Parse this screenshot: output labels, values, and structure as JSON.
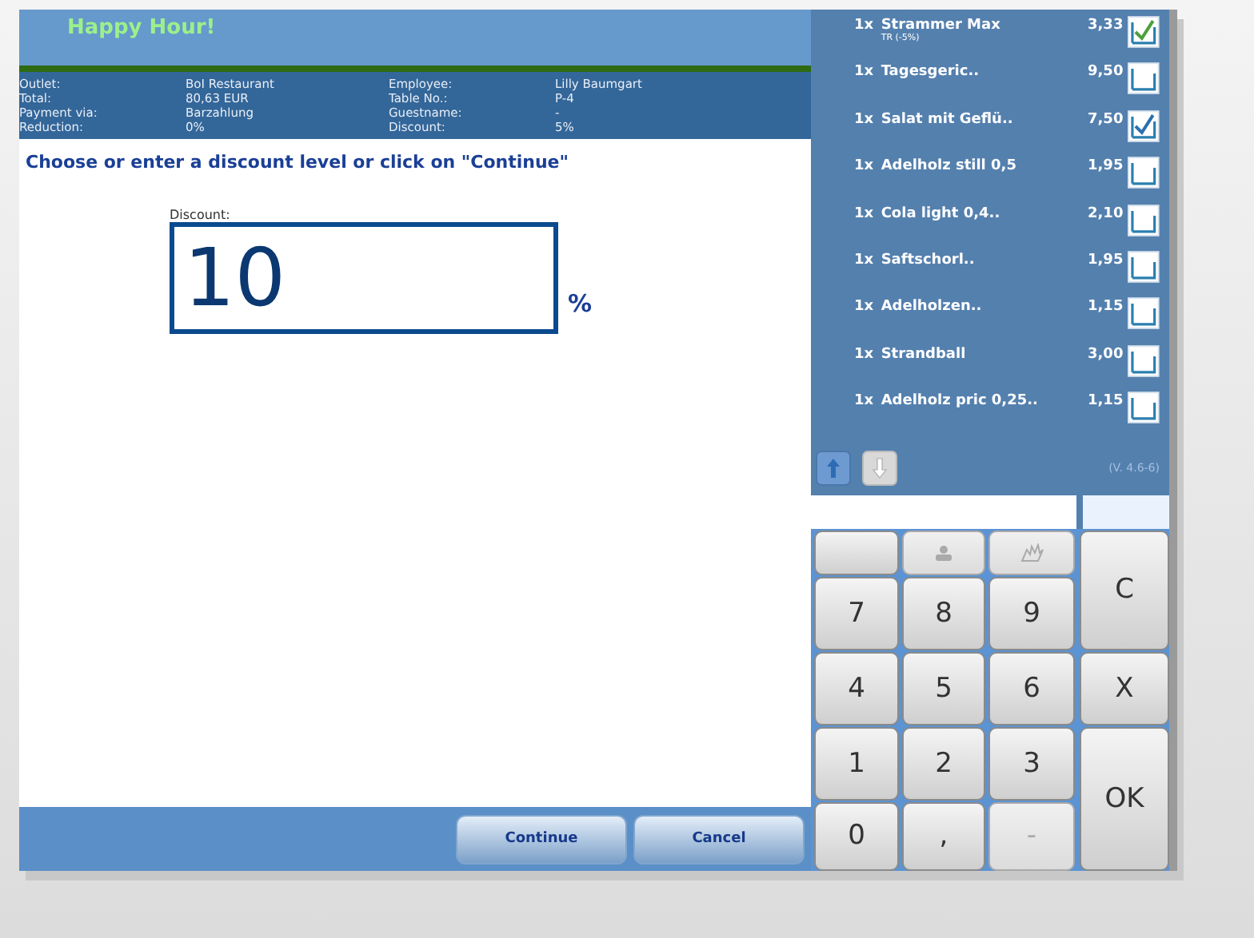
{
  "header": {
    "title": "Happy Hour!"
  },
  "info": [
    {
      "label": "Outlet:",
      "value": "BoI Restaurant"
    },
    {
      "label": "Employee:",
      "value": "Lilly Baumgart"
    },
    {
      "label": "Total:",
      "value": "80,63 EUR"
    },
    {
      "label": "Table No.:",
      "value": "P-4"
    },
    {
      "label": "Payment via:",
      "value": "Barzahlung"
    },
    {
      "label": "Guestname:",
      "value": "-"
    },
    {
      "label": "Reduction:",
      "value": "0%"
    },
    {
      "label": "Discount:",
      "value": "5%"
    }
  ],
  "prompt": "Choose or enter a discount level or click on \"Continue\"",
  "discount_field": {
    "label": "Discount:",
    "value": "10",
    "unit": "%"
  },
  "buttons": [
    {
      "label": "Continue"
    },
    {
      "label": "Cancel"
    }
  ],
  "items": [
    {
      "qty": "1x",
      "name": "Strammer Max",
      "note": "TR (-5%)",
      "price": "3,33",
      "checked": true
    },
    {
      "qty": "1x",
      "name": "Tagesgeric..",
      "price": "9,50",
      "checked": false
    },
    {
      "qty": "1x",
      "name": "Salat mit Geflü..",
      "price": "7,50",
      "checked": true
    },
    {
      "qty": "1x",
      "name": "Adelholz still 0,5",
      "price": "1,95",
      "checked": false
    },
    {
      "qty": "1x",
      "name": "Cola light 0,4..",
      "price": "2,10",
      "checked": false
    },
    {
      "qty": "1x",
      "name": "Saftschorl..",
      "price": "1,95",
      "checked": false
    },
    {
      "qty": "1x",
      "name": "Adelholzen..",
      "price": "1,15",
      "checked": false
    },
    {
      "qty": "1x",
      "name": "Strandball",
      "price": "3,00",
      "checked": false
    },
    {
      "qty": "1x",
      "name": "Adelholz pric 0,25..",
      "price": "1,15",
      "checked": false
    }
  ],
  "version": "(V. 4.6-6)",
  "keypad": [
    {
      "kind": "blank",
      "disabled": false
    },
    {
      "kind": "people",
      "disabled": true
    },
    {
      "kind": "hand",
      "disabled": true
    },
    {
      "kind": "text",
      "label": "7",
      "disabled": false
    },
    {
      "kind": "text",
      "label": "8",
      "disabled": false
    },
    {
      "kind": "text",
      "label": "9",
      "disabled": false
    },
    {
      "kind": "text",
      "label": "4",
      "disabled": false
    },
    {
      "kind": "text",
      "label": "5",
      "disabled": false
    },
    {
      "kind": "text",
      "label": "6",
      "disabled": false
    },
    {
      "kind": "text",
      "label": "1",
      "disabled": false
    },
    {
      "kind": "text",
      "label": "2",
      "disabled": false
    },
    {
      "kind": "text",
      "label": "3",
      "disabled": false
    },
    {
      "kind": "text",
      "label": "0",
      "disabled": false
    },
    {
      "kind": "text",
      "label": ",",
      "disabled": false
    },
    {
      "kind": "text",
      "label": "-",
      "disabled": true
    }
  ],
  "side_keys": [
    {
      "label": "C"
    },
    {
      "label": "X"
    },
    {
      "label": "OK"
    }
  ]
}
